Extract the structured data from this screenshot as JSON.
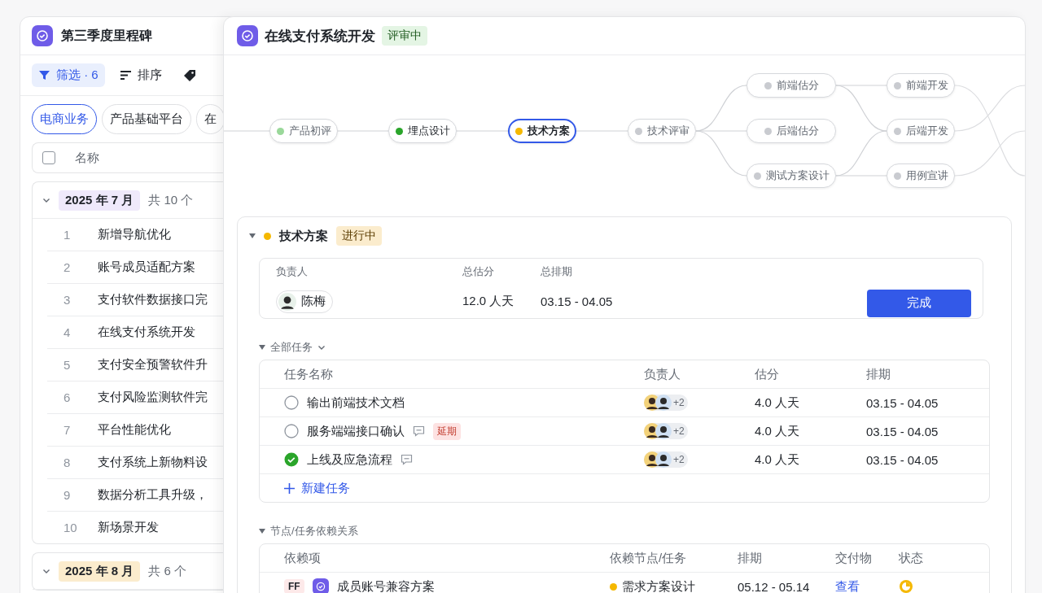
{
  "left_panel": {
    "title": "第三季度里程碑",
    "toolbar": [
      {
        "kind": "filter",
        "label": "筛选 · 6",
        "selected": true
      },
      {
        "kind": "sort",
        "label": "排序",
        "selected": false
      },
      {
        "kind": "tag",
        "selected": false
      }
    ],
    "chips": [
      {
        "label": "电商业务",
        "selected": true
      },
      {
        "label": "产品基础平台",
        "selected": false
      },
      {
        "label": "在",
        "selected": false
      }
    ],
    "table_header": {
      "checked": false,
      "label": "名称"
    },
    "groups": [
      {
        "title": "2025 年 7 月",
        "count": "共 10 个",
        "color": "#efe9fb",
        "expanded": true,
        "rows": [
          {
            "index": "1",
            "name": "新增导航优化"
          },
          {
            "index": "2",
            "name": "账号成员适配方案"
          },
          {
            "index": "3",
            "name": "支付软件数据接口完"
          },
          {
            "index": "4",
            "name": "在线支付系统开发"
          },
          {
            "index": "5",
            "name": "支付安全预警软件升"
          },
          {
            "index": "6",
            "name": "支付风险监测软件完"
          },
          {
            "index": "7",
            "name": "平台性能优化"
          },
          {
            "index": "8",
            "name": "支付系统上新物料设"
          },
          {
            "index": "9",
            "name": "数据分析工具升级，"
          },
          {
            "index": "10",
            "name": "新场景开发"
          }
        ]
      },
      {
        "title": "2025 年 8 月",
        "count": "共 6 个",
        "color": "#fbeccd",
        "expanded": true
      }
    ]
  },
  "detail": {
    "title": "在线支付系统开发",
    "status": "评审中",
    "flow": {
      "stages": [
        [
          {
            "label": "产品初评",
            "color": "#9ad89a",
            "muted": true,
            "selected": false
          }
        ],
        [
          {
            "label": "埋点设计",
            "color": "#2aa52a",
            "muted": false,
            "selected": false
          }
        ],
        [
          {
            "label": "技术方案",
            "color": "#f5b800",
            "muted": false,
            "selected": true
          }
        ],
        [
          {
            "label": "技术评审",
            "color": "#c9cbd0",
            "muted": true,
            "selected": false
          }
        ],
        [
          {
            "label": "前端估分",
            "color": "#c9cbd0",
            "muted": true,
            "selected": false
          },
          {
            "label": "后端估分",
            "color": "#c9cbd0",
            "muted": true,
            "selected": false
          },
          {
            "label": "测试方案设计",
            "color": "#c9cbd0",
            "muted": true,
            "selected": false
          }
        ],
        [
          {
            "label": "前端开发",
            "color": "#c9cbd0",
            "muted": true,
            "selected": false
          },
          {
            "label": "后端开发",
            "color": "#c9cbd0",
            "muted": true,
            "selected": false
          },
          {
            "label": "用例宣讲",
            "color": "#c9cbd0",
            "muted": true,
            "selected": false
          }
        ]
      ]
    },
    "node": {
      "title": "技术方案",
      "status": "进行中",
      "expanded": true,
      "summary": {
        "owner_label": "负责人",
        "owner": "陈梅",
        "estimate_label": "总估分",
        "estimate": "12.0 人天",
        "schedule_label": "总排期",
        "schedule": "03.15 - 04.05",
        "button": "完成"
      },
      "tasks": {
        "title": "全部任务",
        "expanded": true,
        "columns": [
          "任务名称",
          "负责人",
          "估分",
          "排期"
        ],
        "rows": [
          {
            "name": "输出前端技术文档",
            "done": false,
            "comment": false,
            "more_owners": "+2",
            "estimate": "4.0 人天",
            "schedule": "03.15 - 04.05"
          },
          {
            "name": "服务端端接口确认",
            "done": false,
            "comment": true,
            "tag": "延期",
            "more_owners": "+2",
            "estimate": "4.0 人天",
            "schedule": "03.15 - 04.05"
          },
          {
            "name": "上线及应急流程",
            "done": true,
            "comment": true,
            "more_owners": "+2",
            "estimate": "4.0 人天",
            "schedule": "03.15 - 04.05"
          }
        ],
        "add": "新建任务"
      },
      "dependencies": {
        "title": "节点/任务依赖关系",
        "expanded": true,
        "columns": [
          "依赖项",
          "依赖节点/任务",
          "排期",
          "交付物",
          "状态"
        ],
        "rows": [
          {
            "type": "FF",
            "item": "成员账号兼容方案",
            "node": "需求方案设计",
            "color": "#f5b800",
            "schedule": "05.12 - 05.14",
            "deliverable": "查看"
          }
        ]
      }
    }
  }
}
